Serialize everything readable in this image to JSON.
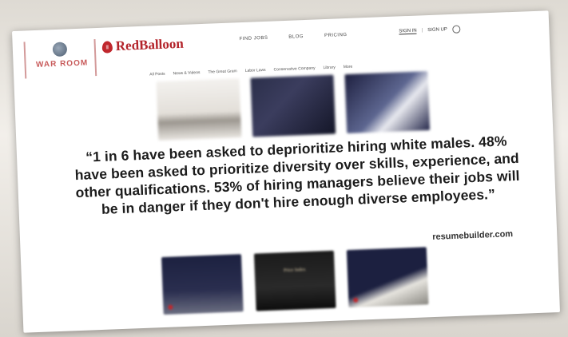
{
  "brand": {
    "warroom_label": "WAR ROOM",
    "logo_text": "RedBalloon",
    "accent_color": "#c0272d"
  },
  "topnav": [
    "FIND JOBS",
    "BLOG",
    "PRICING"
  ],
  "auth": {
    "signin": "SIGN IN",
    "separator": "|",
    "signup": "SIGN UP"
  },
  "categories": [
    "All Posts",
    "News & Videos",
    "The Great Gram",
    "Labor Laws",
    "Conservative Company",
    "Library",
    "More"
  ],
  "quote": "“1 in 6 have been asked to deprioritize hiring white males. 48% have been asked to prioritize diversity over skills, experience, and other qualifications. 53% of hiring managers believe their jobs will be in danger if they don't hire enough diverse employees.”",
  "source": "resumebuilder.com",
  "bottom_thumb_text": "Price Index"
}
